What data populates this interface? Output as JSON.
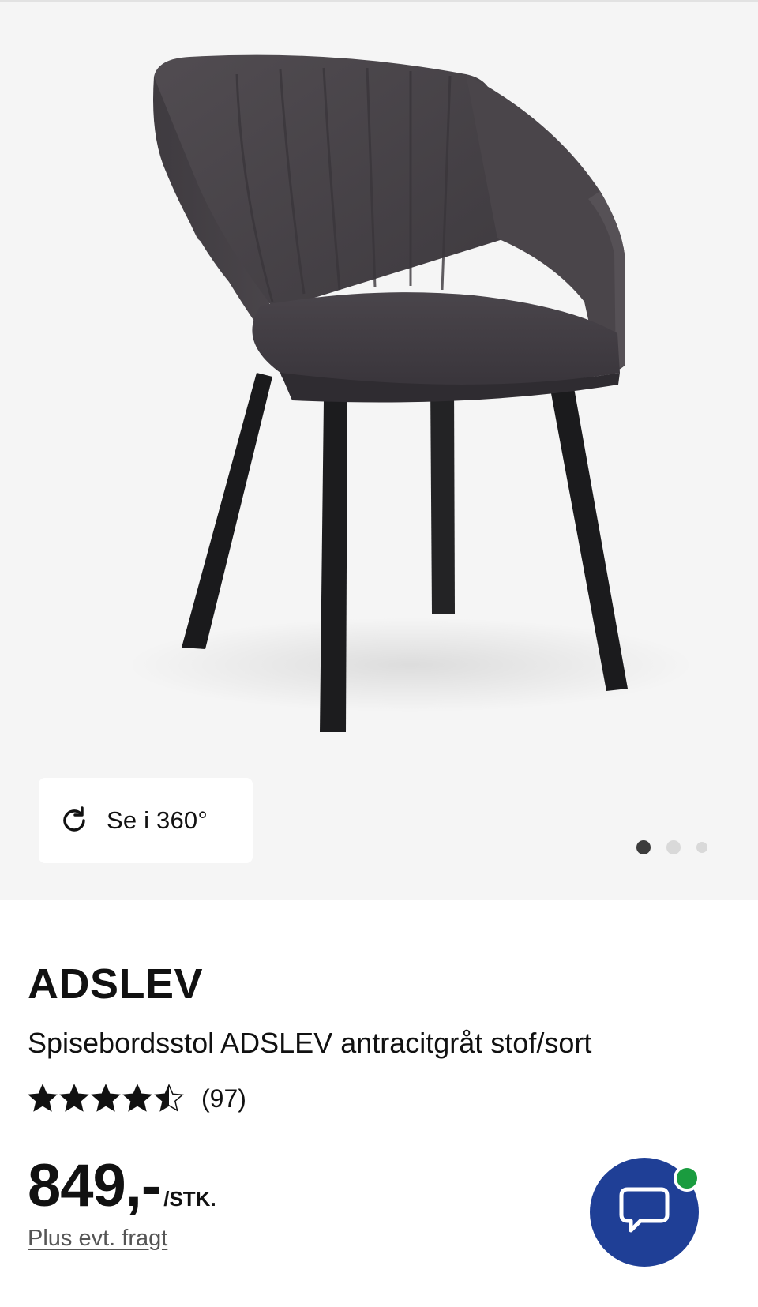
{
  "gallery": {
    "view_360_label": "Se i 360°",
    "slide_count": 3,
    "active_slide": 1,
    "image_subject": "dining chair, anthracite fabric, black legs"
  },
  "product": {
    "brand": "ADSLEV",
    "title": "Spisebordsstol ADSLEV antracitgråt stof/sort",
    "rating": 4.5,
    "rating_max": 5,
    "review_count": "(97)",
    "price": "849,-",
    "unit": "/STK.",
    "shipping_note": "Plus evt. fragt"
  },
  "chat": {
    "online": true,
    "button_color": "#1f3f96",
    "badge_color": "#1a9c3f"
  },
  "icons": {
    "rotate": "rotate-icon",
    "star": "star-icon",
    "chat": "chat-bubble-icon"
  }
}
